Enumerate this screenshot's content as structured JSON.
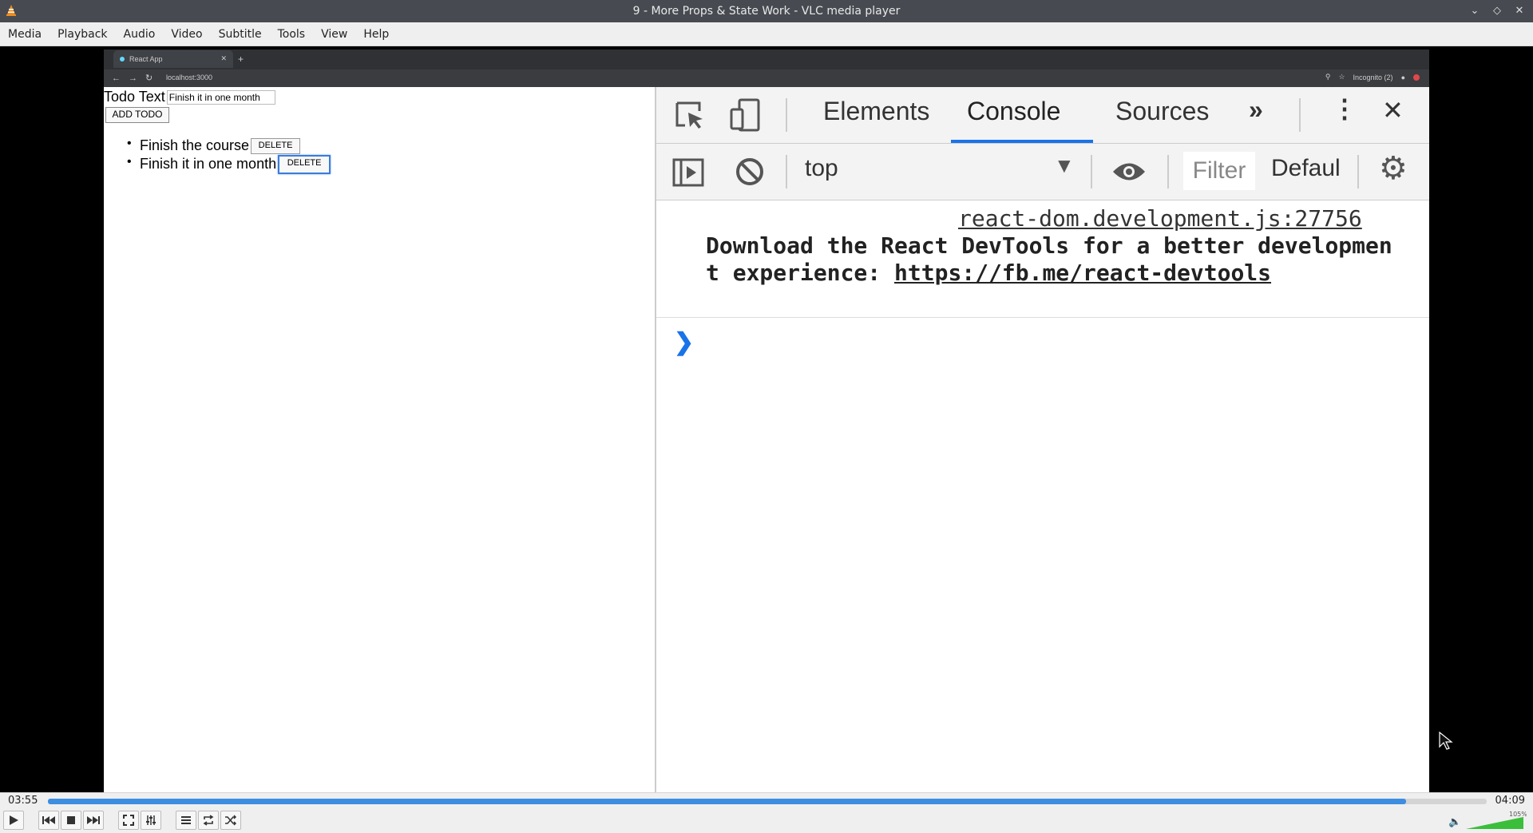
{
  "window": {
    "title": "9 - More Props & State Work - VLC media player"
  },
  "menu": [
    "Media",
    "Playback",
    "Audio",
    "Video",
    "Subtitle",
    "Tools",
    "View",
    "Help"
  ],
  "browser": {
    "tab_title": "React App",
    "url": "localhost:3000",
    "incognito": "Incognito (2)"
  },
  "app": {
    "label": "Todo Text",
    "input_value": "Finish it in one month",
    "add_button": "ADD TODO",
    "todos": [
      {
        "text": "Finish the course",
        "delete": "DELETE"
      },
      {
        "text": "Finish it in one month",
        "delete": "DELETE"
      }
    ]
  },
  "devtools": {
    "tabs": {
      "elements": "Elements",
      "console": "Console",
      "sources": "Sources"
    },
    "context": "top",
    "filter": "Filter",
    "levels": "Defaul",
    "log_source": "react-dom.development.js:27756",
    "log_text": "Download the React DevTools for a better development experience: ",
    "log_link": "https://fb.me/react-devtools"
  },
  "player": {
    "elapsed": "03:55",
    "total": "04:09",
    "progress": 0.944,
    "volume": "105%",
    "accent": "#3d8ee0"
  }
}
